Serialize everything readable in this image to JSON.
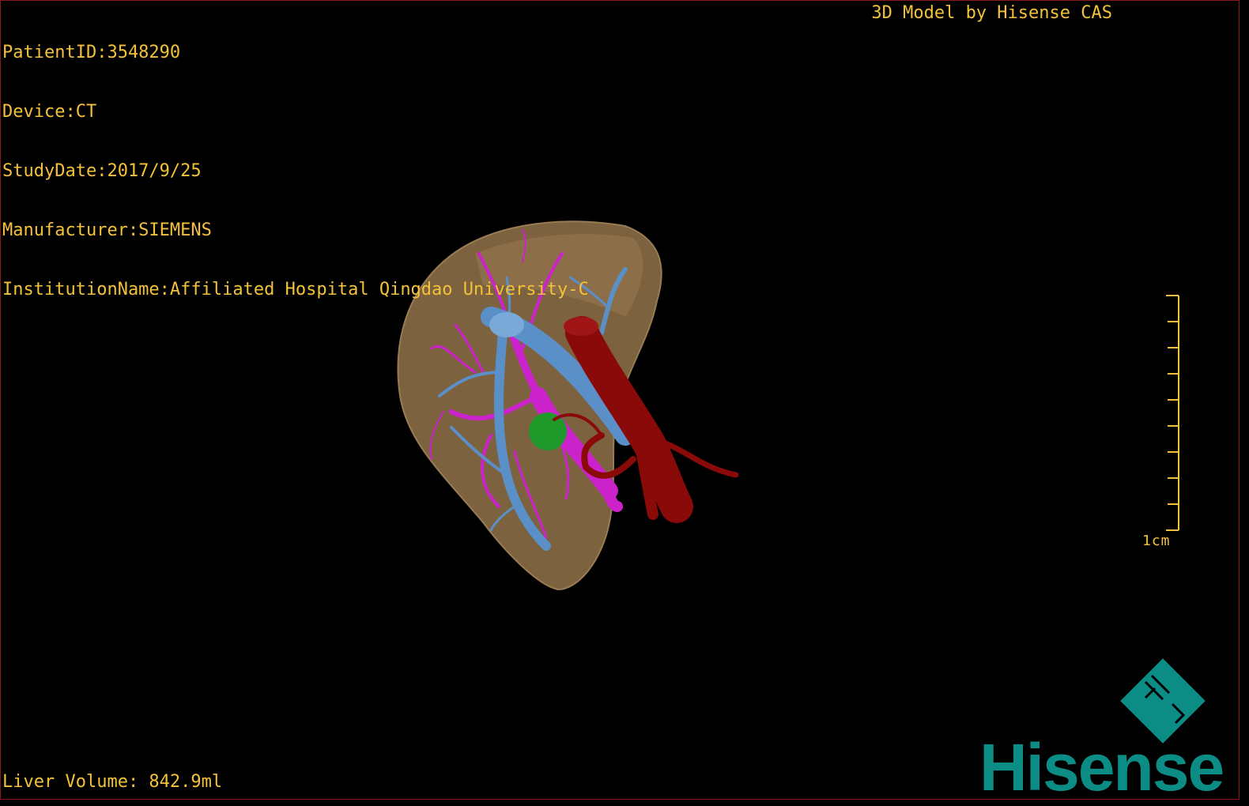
{
  "header": {
    "patient_id": "PatientID:3548290",
    "device": "Device:CT",
    "study_date": "StudyDate:2017/9/25",
    "manufacturer": "Manufacturer:SIEMENS",
    "institution": "InstitutionName:Affiliated Hospital Qingdao University-C"
  },
  "credit": "3D Model by Hisense CAS",
  "scale_bar": {
    "label": "1cm"
  },
  "footer": {
    "liver_volume": "Liver Volume: 842.9ml"
  },
  "logo": {
    "wordmark": "Hisense",
    "color": "#0b8d86"
  },
  "colors": {
    "overlay_text": "#f4c13a",
    "liver": "#8a6a44",
    "portal_vein": "#cc22cc",
    "hepatic_vein": "#5b8fc7",
    "artery": "#8a0a0a",
    "tumor": "#1f9a2a",
    "frame_border": "#8a1a1a"
  }
}
